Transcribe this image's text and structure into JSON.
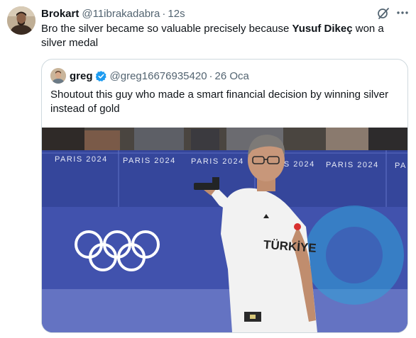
{
  "tweet": {
    "author_name": "Brokart",
    "author_handle": "@11ibrakadabra",
    "separator": "·",
    "time": "12s",
    "text_before": "Bro the silver became so valuable precisely because ",
    "text_bold": "Yusuf Dikeç",
    "text_after": " won a silver medal",
    "icons": {
      "avatar": "avatar-photo",
      "grok": "grok-icon",
      "more": "more-icon"
    }
  },
  "quote": {
    "author_name": "greg",
    "author_handle": "@greg16676935420",
    "separator": "·",
    "date": "26 Oca",
    "text": "Shoutout this guy who made a smart financial decision by winning silver instead of gold",
    "verified_color": "#1d9bf0",
    "media": {
      "banner_texts": [
        "PARIS 2024",
        "PARIS 2024",
        "PARIS 2024",
        "PARIS 2024",
        "PARIS 2024",
        "PA"
      ],
      "shirt_text": "TÜRKİYE",
      "colors": {
        "wall": "#3e4fa8",
        "banner": "#35469b",
        "shirt": "#f2f2f2",
        "rings": "#ffffff",
        "accent": "#2fa3d8"
      }
    }
  }
}
